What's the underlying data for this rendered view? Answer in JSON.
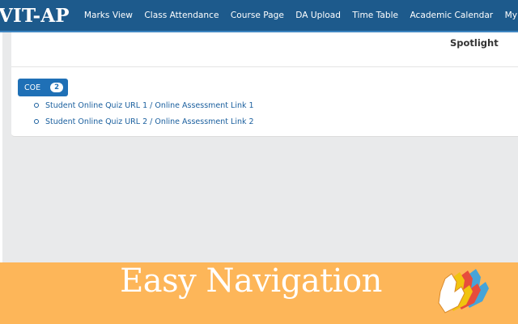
{
  "navbar": {
    "brand": "VIT-AP",
    "links": [
      "Marks View",
      "Class Attendance",
      "Course Page",
      "DA Upload",
      "Time Table",
      "Academic Calendar",
      "My Curriculum"
    ]
  },
  "main": {
    "spotlight_label": "Spotlight",
    "coe": {
      "label": "COE",
      "count": "2"
    },
    "links": [
      "Student Online Quiz URL 1 / Online Assessment Link 1",
      "Student Online Quiz URL 2 / Online Assessment Link 2"
    ]
  },
  "banner": {
    "title": "Easy Navigation",
    "icon": "hand-pointer-icon"
  },
  "colors": {
    "navbar": "#1d5a8c",
    "accent": "#1f70b6",
    "banner": "#fdb659",
    "link": "#1a5f9e"
  }
}
